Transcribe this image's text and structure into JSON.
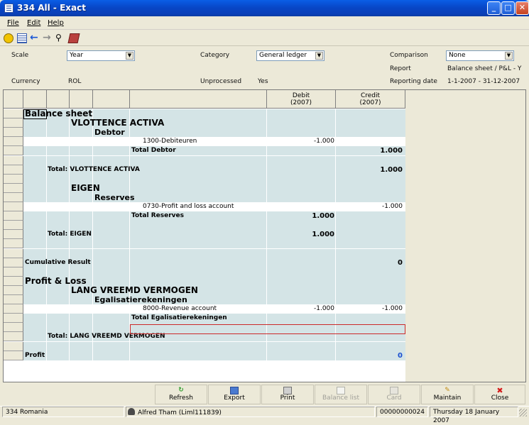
{
  "window": {
    "title": "334 All - Exact"
  },
  "menu": {
    "file": "File",
    "edit": "Edit",
    "help": "Help"
  },
  "params": {
    "scale_label": "Scale",
    "scale_value": "Year",
    "category_label": "Category",
    "category_value": "General ledger",
    "comparison_label": "Comparison",
    "comparison_value": "None",
    "report_label": "Report",
    "report_value": "Balance sheet / P&L - Y",
    "currency_label": "Currency",
    "currency_value": "ROL",
    "unprocessed_label": "Unprocessed",
    "unprocessed_value": "Yes",
    "reporting_date_label": "Reporting date",
    "reporting_date_value": "1-1-2007 - 31-12-2007"
  },
  "grid": {
    "header": {
      "debit": "Debit",
      "debit_year": "(2007)",
      "credit": "Credit",
      "credit_year": "(2007)"
    },
    "rows": [
      {
        "text": "Balance sheet",
        "level": "t1",
        "debit": "",
        "credit": ""
      },
      {
        "text": "VLOTTENCE ACTIVA",
        "level": "t2",
        "debit": "",
        "credit": ""
      },
      {
        "text": "Debtor",
        "level": "t3",
        "debit": "",
        "credit": ""
      },
      {
        "text": "1300-Debiteuren",
        "level": "acct",
        "debit": "-1.000",
        "credit": ""
      },
      {
        "text": "Total Debtor",
        "level": "tot3",
        "debit": "",
        "credit": "1.000"
      },
      {
        "text": "",
        "level": "blank",
        "debit": "",
        "credit": ""
      },
      {
        "text": "Total: VLOTTENCE ACTIVA",
        "level": "tot1",
        "debit": "",
        "credit": "1.000"
      },
      {
        "text": "",
        "level": "blank",
        "debit": "",
        "credit": ""
      },
      {
        "text": "EIGEN",
        "level": "t2",
        "debit": "",
        "credit": ""
      },
      {
        "text": "Reserves",
        "level": "t3",
        "debit": "",
        "credit": ""
      },
      {
        "text": "0730-Profit and loss account",
        "level": "acct",
        "debit": "",
        "credit": "-1.000"
      },
      {
        "text": "Total Reserves",
        "level": "tot3",
        "debit": "1.000",
        "credit": ""
      },
      {
        "text": "",
        "level": "blank",
        "debit": "",
        "credit": ""
      },
      {
        "text": "Total: EIGEN",
        "level": "tot1",
        "debit": "1.000",
        "credit": ""
      },
      {
        "text": "",
        "level": "blank",
        "debit": "",
        "credit": ""
      },
      {
        "text": "",
        "level": "blank",
        "debit": "",
        "credit": ""
      },
      {
        "text": "Cumulative Result",
        "level": "tot0",
        "debit": "",
        "credit": "0"
      },
      {
        "text": "",
        "level": "blank",
        "debit": "",
        "credit": ""
      },
      {
        "text": "Profit & Loss",
        "level": "t1",
        "debit": "",
        "credit": ""
      },
      {
        "text": "LANG VREEMD VERMOGEN",
        "level": "t2",
        "debit": "",
        "credit": ""
      },
      {
        "text": "Egalisatierekeningen",
        "level": "t3",
        "debit": "",
        "credit": ""
      },
      {
        "text": "8000-Revenue account",
        "level": "acct",
        "debit": "-1.000",
        "credit": "-1.000"
      },
      {
        "text": "Total Egalisatierekeningen",
        "level": "tot3",
        "debit": "",
        "credit": ""
      },
      {
        "text": "",
        "level": "blank",
        "debit": "",
        "credit": ""
      },
      {
        "text": "Total: LANG VREEMD VERMOGEN",
        "level": "tot1",
        "debit": "",
        "credit": ""
      },
      {
        "text": "",
        "level": "blank",
        "debit": "",
        "credit": ""
      },
      {
        "text": "Profit",
        "level": "tot0",
        "debit": "",
        "credit": "0"
      }
    ]
  },
  "buttons": {
    "refresh": "Refresh",
    "export": "Export",
    "print": "Print",
    "balance_list": "Balance list",
    "card": "Card",
    "maintain": "Maintain",
    "close": "Close"
  },
  "status": {
    "company": "334 Romania",
    "user": "Alfred Tham (Liml111839)",
    "code": "00000000024",
    "date": "Thursday 18 January 2007"
  },
  "colors": {
    "band": "#d4e4e6",
    "title_bar": "#0a5ee6",
    "highlight_border": "#cc2a2a",
    "profit_value": "#1a4fd0"
  }
}
